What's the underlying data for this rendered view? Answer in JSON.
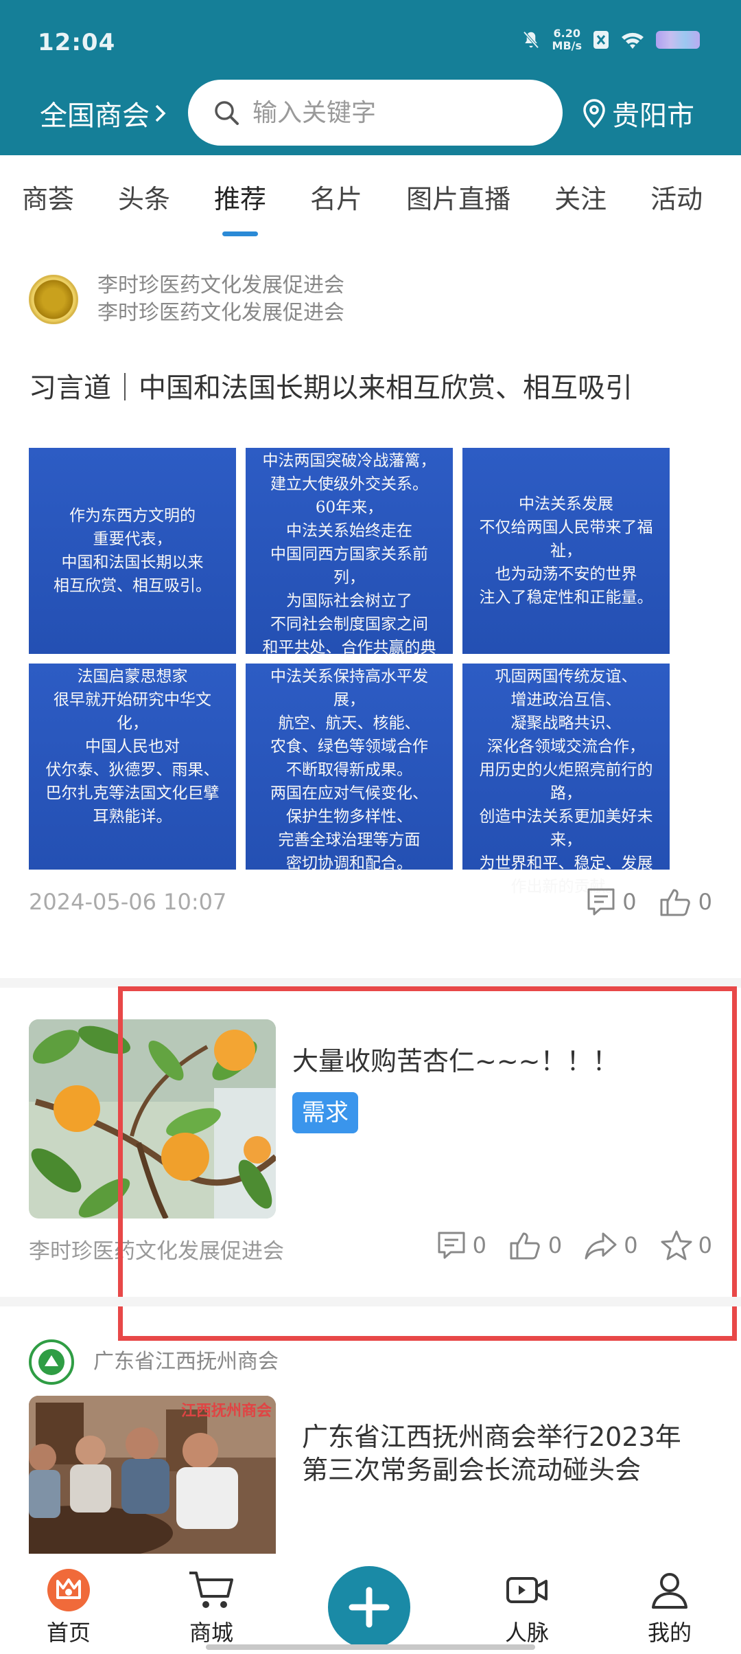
{
  "status_bar": {
    "time": "12:04",
    "net_speed_value": "6.20",
    "net_speed_unit": "MB/s"
  },
  "header": {
    "region_label": "全国商会",
    "search_placeholder": "输入关键字",
    "city_label": "贵阳市"
  },
  "tabs": [
    {
      "label": "商荟",
      "active": false
    },
    {
      "label": "头条",
      "active": false
    },
    {
      "label": "推荐",
      "active": true
    },
    {
      "label": "名片",
      "active": false
    },
    {
      "label": "图片直播",
      "active": false
    },
    {
      "label": "关注",
      "active": false
    },
    {
      "label": "活动",
      "active": false
    }
  ],
  "post1": {
    "author_line1": "李时珍医药文化发展促进会",
    "author_line2": "李时珍医药文化发展促进会",
    "title": "习言道｜中国和法国长期以来相互欣赏、相互吸引",
    "images": [
      "作为东西方文明的\n重要代表，\n中国和法国长期以来\n相互欣赏、相互吸引。",
      "中法两国突破冷战藩篱，\n建立大使级外交关系。\n60年来，\n中法关系始终走在\n中国同西方国家关系前列，\n为国际社会树立了\n不同社会制度国家之间\n和平共处、合作共赢的典范。",
      "中法关系发展\n不仅给两国人民带来了福祉，\n也为动荡不安的世界\n注入了稳定性和正能量。",
      "法国启蒙思想家\n很早就开始研究中华文化，\n中国人民也对\n伏尔泰、狄德罗、雨果、\n巴尔扎克等法国文化巨擘\n耳熟能详。",
      "中法关系保持高水平发展，\n航空、航天、核能、\n农食、绿色等领域合作\n不断取得新成果。\n两国在应对气候变化、\n保护生物多样性、\n完善全球治理等方面\n密切协调和配合。",
      "巩固两国传统友谊、\n增进政治互信、\n凝聚战略共识、\n深化各领域交流合作，\n用历史的火炬照亮前行的路，\n创造中法关系更加美好未来，\n为世界和平、稳定、发展\n作出新的贡献。"
    ],
    "date": "2024-05-06 10:07",
    "comments": "0",
    "likes": "0"
  },
  "post2": {
    "title": "大量收购苦杏仁~~~！！！",
    "tag": "需求",
    "source": "李时珍医药文化发展促进会",
    "comments": "0",
    "likes": "0",
    "shares": "0",
    "favorites": "0"
  },
  "post3": {
    "author": "广东省江西抚州商会",
    "thumb_caption": "江西抚州商会",
    "title": "广东省江西抚州商会举行2023年第三次常务副会长流动碰头会"
  },
  "bottom_nav": {
    "home": "首页",
    "mall": "商城",
    "contacts": "人脉",
    "mine": "我的"
  },
  "colors": {
    "header_bg": "#157f98",
    "accent_blue": "#2b8ad6",
    "tag_blue": "#3a95ec",
    "highlight_red": "#e84848",
    "home_orange": "#f06a3a"
  }
}
